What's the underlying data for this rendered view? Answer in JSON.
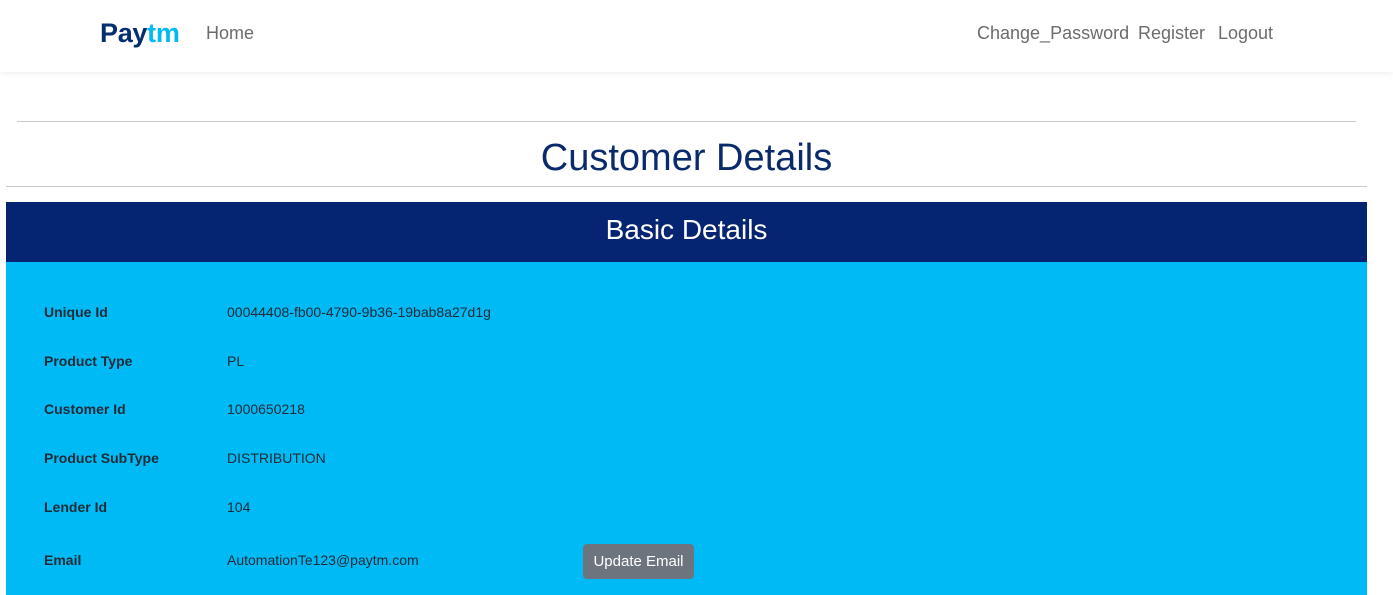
{
  "brand": {
    "part1": "Pay",
    "part2": "tm"
  },
  "nav": {
    "home": "Home",
    "change_password": "Change_Password",
    "register": "Register",
    "logout": "Logout"
  },
  "page_title": "Customer Details",
  "section": {
    "title": "Basic Details",
    "rows": [
      {
        "label": "Unique Id",
        "value": "00044408-fb00-4790-9b36-19bab8a27d1g"
      },
      {
        "label": "Product Type",
        "value": "PL"
      },
      {
        "label": "Customer Id",
        "value": "1000650218"
      },
      {
        "label": "Product SubType",
        "value": "DISTRIBUTION"
      },
      {
        "label": "Lender Id",
        "value": "104"
      },
      {
        "label": "Email",
        "value": "AutomationTe123@paytm.com"
      }
    ],
    "update_email_label": "Update Email"
  },
  "colors": {
    "brand_dark": "#042e6f",
    "brand_light": "#00baf2",
    "header_bg": "#052471",
    "body_bg": "#00baf5",
    "button_bg": "#6c757d"
  }
}
